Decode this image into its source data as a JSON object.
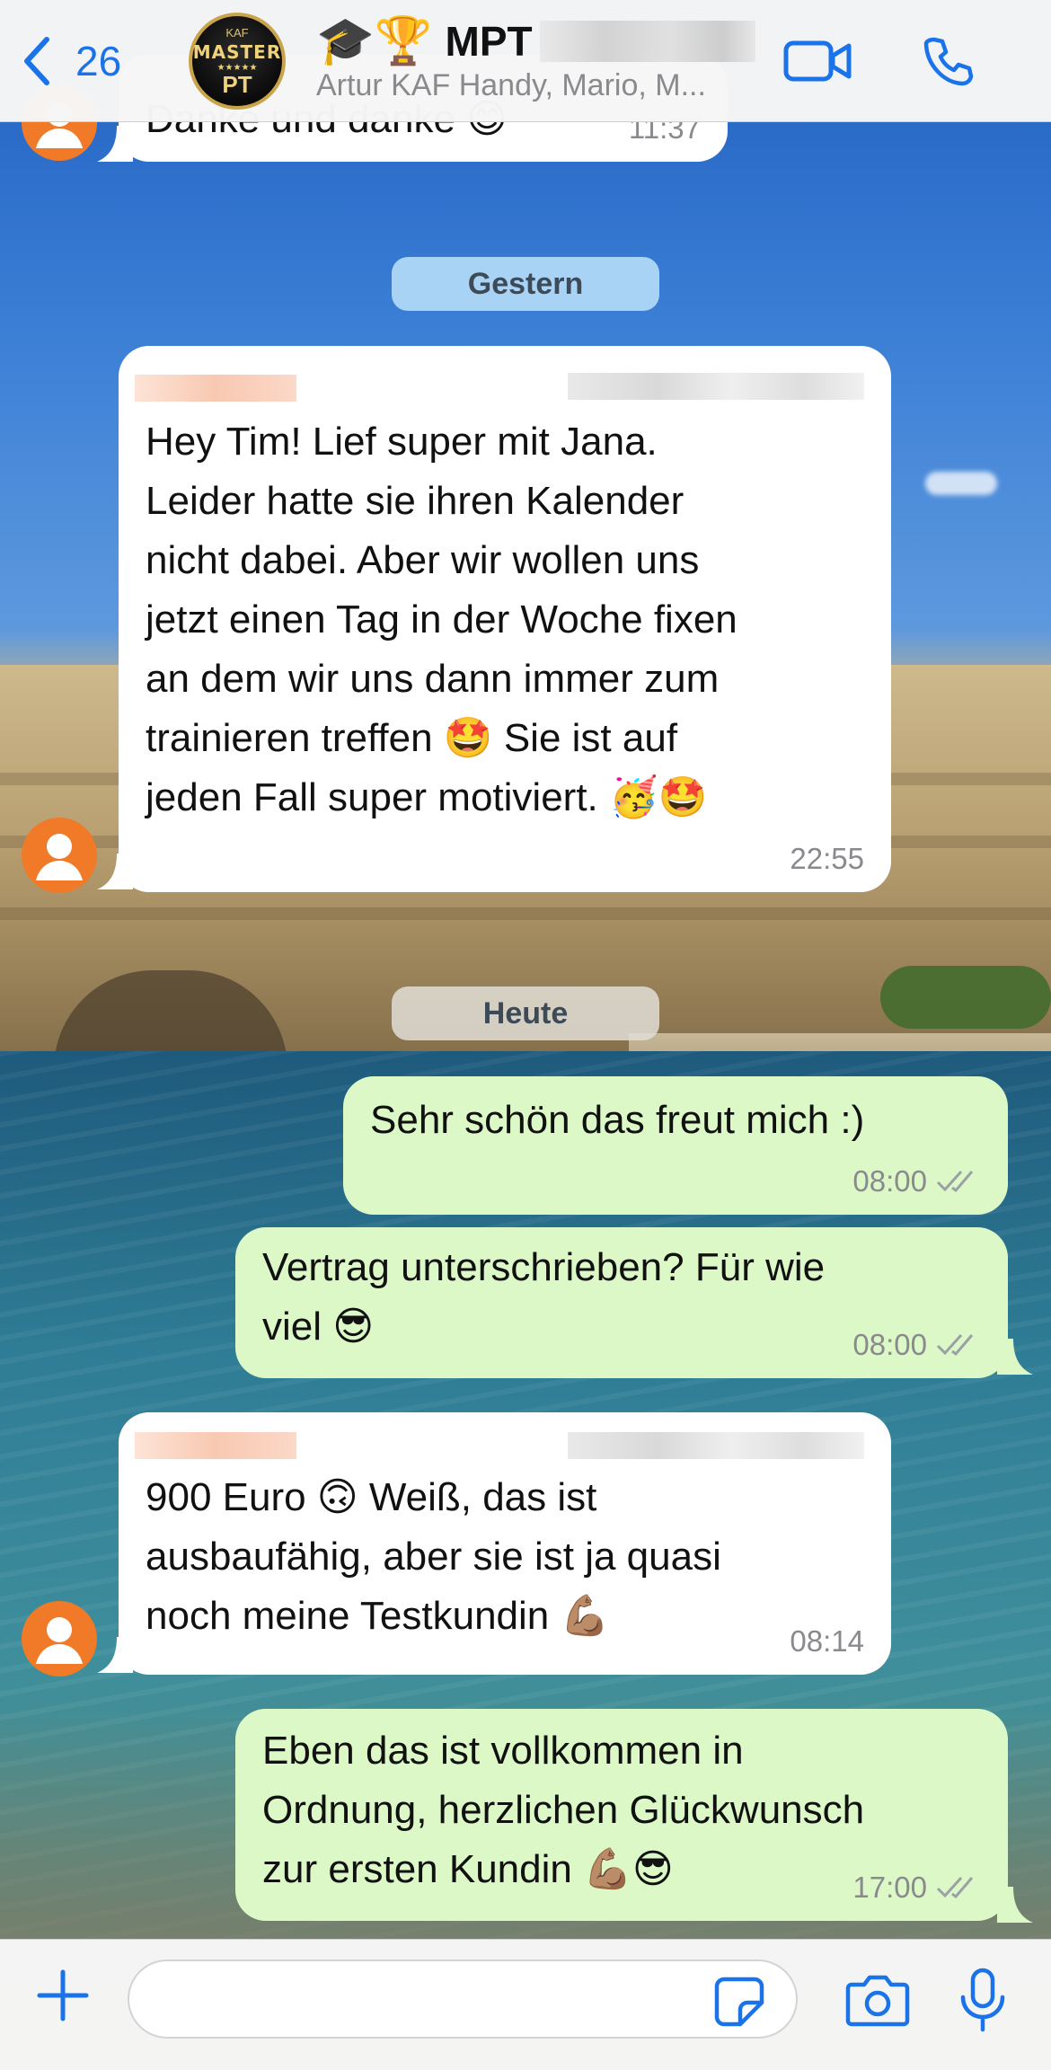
{
  "header": {
    "back_count": "26",
    "group_avatar_top": "KAF",
    "group_avatar_master": "MASTER",
    "group_avatar_stars": "★★★★★",
    "group_avatar_pt": "PT",
    "title_emoji": "🎓🏆",
    "title": "MPT",
    "subtitle": "Artur KAF Handy, Mario, M..."
  },
  "dates": {
    "yesterday": "Gestern",
    "today": "Heute"
  },
  "messages": [
    {
      "direction": "in",
      "text": "Danke und danke 😊",
      "time": "11:37"
    },
    {
      "direction": "in",
      "text": "Hey Tim! Lief super mit Jana.\nLeider hatte sie ihren Kalender\nnicht dabei. Aber wir wollen uns\njetzt einen Tag in der Woche fixen\nan dem wir uns dann immer zum\ntrainieren treffen 🤩 Sie ist auf\njeden Fall super motiviert. 🥳🤩",
      "time": "22:55"
    },
    {
      "direction": "out",
      "text": "Sehr schön das freut mich :)",
      "time": "08:00"
    },
    {
      "direction": "out",
      "text": "Vertrag unterschrieben? Für wie\nviel 😎",
      "time": "08:00"
    },
    {
      "direction": "in",
      "text": "900 Euro 🙃 Weiß, das ist\nausbaufähig, aber sie ist ja quasi\nnoch meine Testkundin 💪🏽",
      "time": "08:14"
    },
    {
      "direction": "out",
      "text": "Eben das ist vollkommen in\nOrdnung, herzlichen Glückwunsch\nzur ersten Kundin 💪🏽😎",
      "time": "17:00"
    }
  ],
  "colors": {
    "accent": "#1a73e8",
    "outgoing_bubble": "#dcf8c6",
    "incoming_bubble": "#ffffff",
    "avatar": "#f07a28"
  },
  "icons": {
    "back": "chevron-left-icon",
    "video": "video-camera-icon",
    "call": "phone-icon",
    "attach": "plus-icon",
    "sticker": "sticker-icon",
    "camera": "camera-icon",
    "mic": "microphone-icon",
    "read": "double-check-icon"
  }
}
